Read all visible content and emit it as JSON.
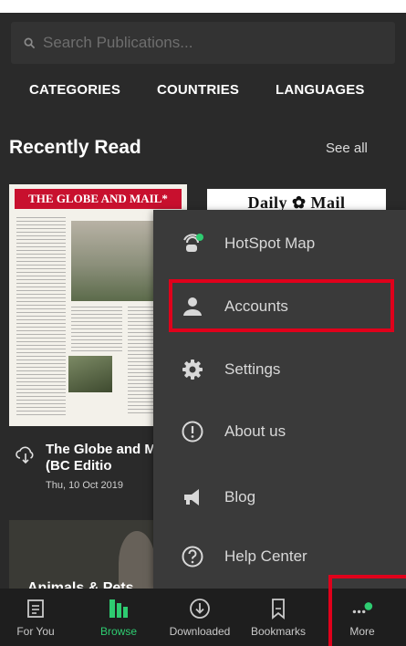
{
  "search": {
    "placeholder": "Search Publications..."
  },
  "filter_tabs": [
    {
      "label": "CATEGORIES"
    },
    {
      "label": "COUNTRIES"
    },
    {
      "label": "LANGUAGES"
    }
  ],
  "recently_read": {
    "title": "Recently Read",
    "see_all": "See all",
    "items": [
      {
        "masthead": "THE GLOBE AND MAIL*",
        "title": "The Globe and Mail (BC Editio",
        "date": "Thu, 10 Oct 2019"
      },
      {
        "masthead": "Daily ✿ Mail"
      }
    ],
    "partial_card_title": "Animals & Pets"
  },
  "menu": {
    "items": [
      {
        "label": "HotSpot Map",
        "icon": "hotspot-icon"
      },
      {
        "label": "Accounts",
        "icon": "person-icon"
      },
      {
        "label": "Settings",
        "icon": "gear-icon"
      },
      {
        "label": "About us",
        "icon": "info-icon"
      },
      {
        "label": "Blog",
        "icon": "megaphone-icon"
      },
      {
        "label": "Help Center",
        "icon": "help-icon"
      }
    ]
  },
  "bottom_nav": {
    "items": [
      {
        "label": "For You",
        "icon": "article-icon",
        "active": false
      },
      {
        "label": "Browse",
        "icon": "library-icon",
        "active": true
      },
      {
        "label": "Downloaded",
        "icon": "download-icon",
        "active": false
      },
      {
        "label": "Bookmarks",
        "icon": "bookmark-icon",
        "active": false
      },
      {
        "label": "More",
        "icon": "more-icon",
        "active": false
      }
    ]
  },
  "colors": {
    "accent_green": "#2ecc71",
    "highlight_red": "#e0001b",
    "background": "#2a2a2a",
    "menu_background": "#3a3a3a"
  }
}
